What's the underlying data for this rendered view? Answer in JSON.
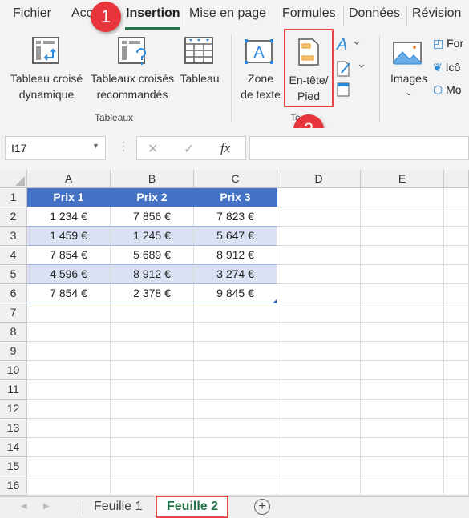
{
  "ribbon": {
    "tabs": [
      "Fichier",
      "Acc",
      "Insertion",
      "Mise en page",
      "Formules",
      "Données",
      "Révision"
    ],
    "active_tab": "Insertion",
    "buttons": {
      "pivot": {
        "line1": "Tableau croisé",
        "line2": "dynamique"
      },
      "recommended": {
        "line1": "Tableaux croisés",
        "line2": "recommandés"
      },
      "table": {
        "line1": "Tableau"
      },
      "textbox": {
        "line1": "Zone",
        "line2": "de texte"
      },
      "headerfooter": {
        "line1": "En-tête/",
        "line2": "Pied"
      },
      "images": {
        "line1": "Images"
      },
      "shapes": "For",
      "icons": "Icô",
      "models": "Mo"
    },
    "groups": {
      "tables": "Tableaux",
      "text": "Te"
    }
  },
  "callouts": {
    "one": "1",
    "two": "2"
  },
  "formula_bar": {
    "name_box": "I17",
    "cancel": "✕",
    "enter": "✓",
    "fx": "fx",
    "value": ""
  },
  "grid": {
    "columns": [
      "A",
      "B",
      "C",
      "D",
      "E"
    ],
    "rows": [
      "1",
      "2",
      "3",
      "4",
      "5",
      "6",
      "7",
      "8",
      "9",
      "10",
      "11",
      "12",
      "13",
      "14",
      "15",
      "16"
    ],
    "table_header": [
      "Prix 1",
      "Prix 2",
      "Prix 3"
    ],
    "table_rows": [
      [
        "1 234 €",
        "7 856 €",
        "7 823 €"
      ],
      [
        "1 459 €",
        "1 245 €",
        "5 647 €"
      ],
      [
        "7 854 €",
        "5 689 €",
        "8 912 €"
      ],
      [
        "4 596 €",
        "8 912 €",
        "3 274 €"
      ],
      [
        "7 854 €",
        "2 378 €",
        "9 845 €"
      ]
    ]
  },
  "colors": {
    "header_fill": "#4472C4",
    "band_fill": "#D9E1F2",
    "accent": "#217346",
    "callout": "#E8353B"
  },
  "sheets": {
    "tabs": [
      "Feuille 1",
      "Feuille 2"
    ],
    "active": "Feuille 2",
    "add": "+"
  }
}
